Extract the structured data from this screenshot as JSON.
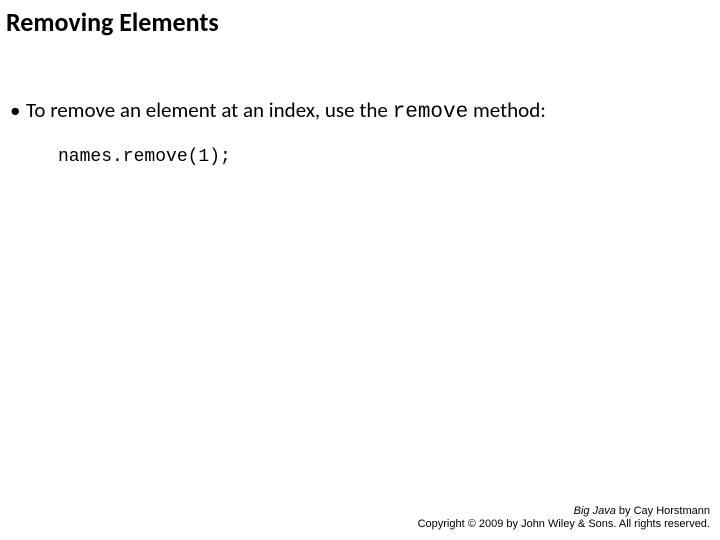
{
  "slide": {
    "title": "Removing Elements",
    "bullet_marker": "•",
    "bullet_text_before": " To remove an element at an index, use the ",
    "bullet_code_word": "remove",
    "bullet_text_after": "  method:",
    "code_line": "names.remove(1);"
  },
  "footer": {
    "book_title": "Big Java",
    "by_author": " by Cay Horstmann",
    "copyright": "Copyright © 2009 by John Wiley & Sons. All rights reserved."
  }
}
